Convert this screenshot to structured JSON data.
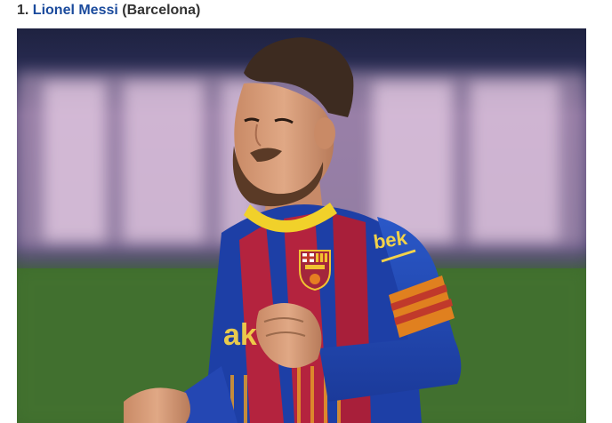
{
  "article_item": {
    "rank": "1.",
    "player_name": "Lionel Messi",
    "club": "(Barcelona)"
  },
  "photo": {
    "subject": "footballer-in-barcelona-kit",
    "shirt_sponsor_text": "Rakuten",
    "sleeve_sponsor_text": "beko",
    "colors": {
      "stadium_sky": "#1f2540",
      "board_glow": "#e8c8e4",
      "pitch": "#3d6b2a",
      "shirt_blue": "#1d3fa6",
      "shirt_red": "#b4233e",
      "collar_yellow": "#f1d12a",
      "armband_orange": "#e0801f",
      "link": "#1a4a9c"
    }
  }
}
